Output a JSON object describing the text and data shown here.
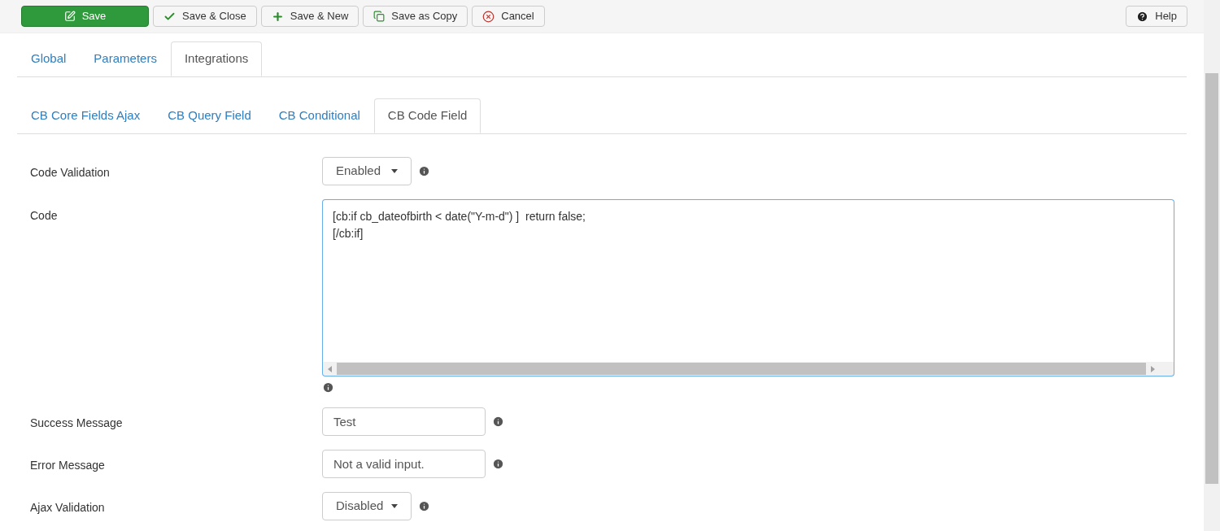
{
  "toolbar": {
    "buttons": [
      {
        "label": "Save",
        "kind": "save"
      },
      {
        "label": "Save & Close",
        "kind": "close"
      },
      {
        "label": "Save & New",
        "kind": "new"
      },
      {
        "label": "Save as Copy",
        "kind": "copy"
      },
      {
        "label": "Cancel",
        "kind": "cancel"
      }
    ],
    "help": {
      "label": "Help"
    }
  },
  "tabs": [
    {
      "label": "Global",
      "selected": false
    },
    {
      "label": "Parameters",
      "selected": false
    },
    {
      "label": "Integrations",
      "selected": true
    }
  ],
  "subtabs": [
    {
      "label": "CB Core Fields Ajax",
      "selected": false
    },
    {
      "label": "CB Query Field",
      "selected": false
    },
    {
      "label": "CB Conditional",
      "selected": false
    },
    {
      "label": "CB Code Field",
      "selected": true
    }
  ],
  "fields": [
    {
      "label": "Code Validation",
      "kind": "select",
      "value": "Enabled"
    },
    {
      "label": "Code",
      "kind": "code",
      "value": "[cb:if cb_dateofbirth < date(\"Y-m-d\") ]  return false;\n[/cb:if]"
    },
    {
      "label": "Success Message",
      "kind": "text",
      "value": "Test"
    },
    {
      "label": "Error Message",
      "kind": "text",
      "value": "Not a valid input."
    },
    {
      "label": "Ajax Validation",
      "kind": "select",
      "value": "Disabled"
    }
  ]
}
